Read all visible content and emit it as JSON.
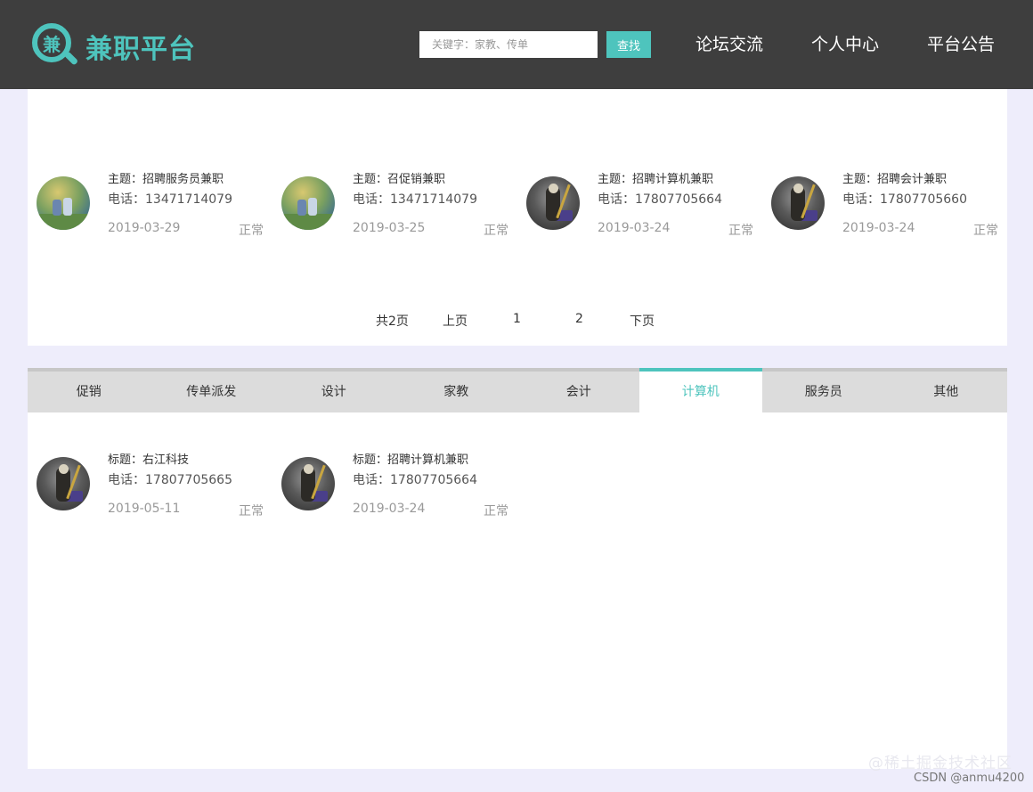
{
  "header": {
    "logo_glyph": "兼",
    "logo_text": "兼职平台",
    "search_placeholder": "关键字：家教、传单",
    "search_button": "查找",
    "nav": [
      "论坛交流",
      "个人中心",
      "平台公告"
    ]
  },
  "top_section": {
    "cards": [
      {
        "title": "主题：招聘服务员兼职",
        "phone": "电话：13471714079",
        "date": "2019-03-29",
        "status": "正常",
        "avatar": "kids-avatar"
      },
      {
        "title": "主题：召促销兼职",
        "phone": "电话：13471714079",
        "date": "2019-03-25",
        "status": "正常",
        "avatar": "kids-avatar"
      },
      {
        "title": "主题：招聘计算机兼职",
        "phone": "电话：17807705664",
        "date": "2019-03-24",
        "status": "正常",
        "avatar": "warrior-avatar"
      },
      {
        "title": "主题：招聘会计兼职",
        "phone": "电话：17807705660",
        "date": "2019-03-24",
        "status": "正常",
        "avatar": "warrior-avatar"
      }
    ],
    "pager": {
      "total": "共2页",
      "prev": "上页",
      "page1": "1",
      "page2": "2",
      "next": "下页"
    }
  },
  "category_section": {
    "tabs": [
      "促销",
      "传单派发",
      "设计",
      "家教",
      "会计",
      "计算机",
      "服务员",
      "其他"
    ],
    "active_tab": "计算机",
    "cards": [
      {
        "title": "标题：右江科技",
        "phone": "电话：17807705665",
        "date": "2019-05-11",
        "status": "正常",
        "avatar": "warrior-avatar"
      },
      {
        "title": "标题：招聘计算机兼职",
        "phone": "电话：17807705664",
        "date": "2019-03-24",
        "status": "正常",
        "avatar": "warrior-avatar"
      }
    ]
  },
  "watermark": {
    "line1": "@稀土掘金技术社区",
    "line2": "CSDN @anmu4200"
  },
  "colors": {
    "accent": "#4ec4bd",
    "header_bg": "#3e3e3e",
    "page_bg": "#eeedfb"
  }
}
